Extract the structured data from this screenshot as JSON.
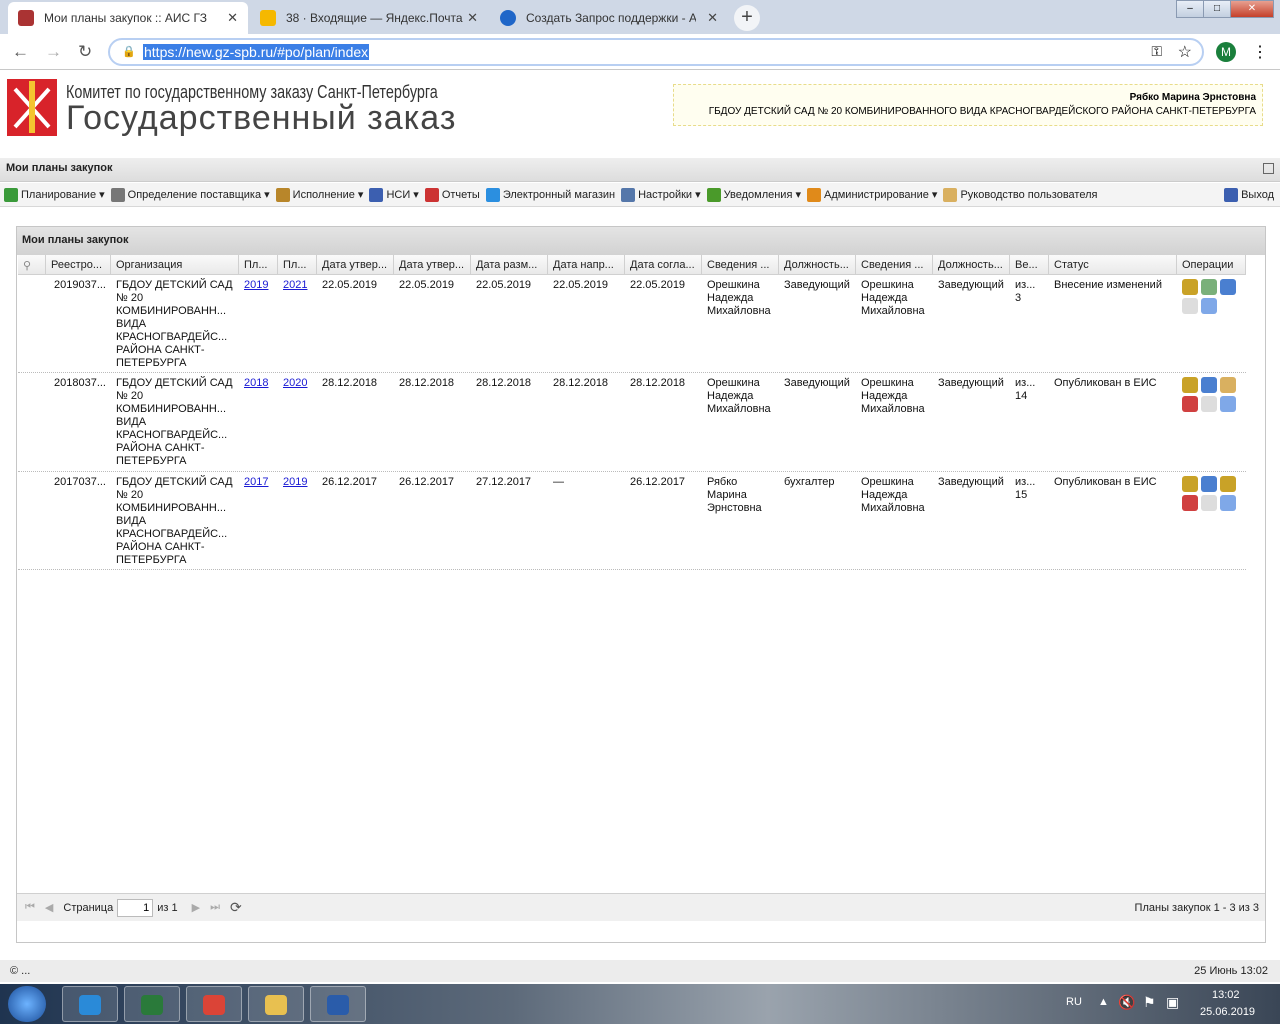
{
  "browser": {
    "tabs": [
      {
        "title": "Мои планы закупок :: АИС ГЗ",
        "icon": "hammer-icon",
        "color": "#a33"
      },
      {
        "title": "38 · Входящие — Яндекс.Почта",
        "icon": "mail-icon",
        "color": "#f5b800"
      },
      {
        "title": "Создать Запрос поддержки - АИС",
        "icon": "help-icon",
        "color": "#1f66c8"
      }
    ],
    "new_tab": "+",
    "url": "https://new.gz-spb.ru/#po/plan/index",
    "avatar": "M",
    "controls": {
      "minimize": "–",
      "maximize": "□",
      "close": "✕"
    }
  },
  "header": {
    "org_line": "Комитет по государственному заказу Санкт-Петербурга",
    "app_name": "Государственный заказ",
    "user_name": "Рябко Марина Эрнстовна",
    "user_org": "ГБДОУ ДЕТСКИЙ САД № 20 КОМБИНИРОВАННОГО ВИДА КРАСНОГВАРДЕЙСКОГО РАЙОНА САНКТ-ПЕТЕРБУРГА"
  },
  "page_title": "Мои планы закупок",
  "menu": [
    {
      "label": "Планирование ▾",
      "color": "#3a9a3a"
    },
    {
      "label": "Определение поставщика ▾",
      "color": "#777"
    },
    {
      "label": "Исполнение ▾",
      "color": "#b8862a"
    },
    {
      "label": "НСИ ▾",
      "color": "#3c5fb0"
    },
    {
      "label": "Отчеты",
      "color": "#c33"
    },
    {
      "label": "Электронный магазин",
      "color": "#2b8fe0"
    },
    {
      "label": "Настройки ▾",
      "color": "#5577aa"
    },
    {
      "label": "Уведомления ▾",
      "color": "#4a9a2a"
    },
    {
      "label": "Администрирование ▾",
      "color": "#e08a1a"
    },
    {
      "label": "Руководство пользователя",
      "color": "#d9b060"
    }
  ],
  "exit_label": "Выход",
  "panel": {
    "title": "Мои планы закупок",
    "columns": [
      "",
      "Реестро...",
      "Организация",
      "Пл...",
      "Пл...",
      "Дата утвер...",
      "Дата утвер...",
      "Дата разм...",
      "Дата напр...",
      "Дата согла...",
      "Сведения ...",
      "Должность...",
      "Сведения ...",
      "Должность...",
      "Ве...",
      "Статус",
      "Операции"
    ],
    "rows": [
      {
        "reg": "2019037...",
        "org": "ГБДОУ ДЕТСКИЙ САД\n№ 20\nКОМБИНИРОВАНН...\nВИДА\nКРАСНОГВАРДЕЙС...\nРАЙОНА САНКТ-\nПЕТЕРБУРГА",
        "y1": "2019",
        "y2": "2021",
        "d1": "22.05.2019",
        "d2": "22.05.2019",
        "d3": "22.05.2019",
        "d4": "22.05.2019",
        "d5": "22.05.2019",
        "p1": "Орешкина\nНадежда\nМихайловна",
        "pos1": "Заведующий",
        "p2": "Орешкина\nНадежда\nМихайловна",
        "pos2": "Заведующий",
        "ver": "из...\n3",
        "status": "Внесение изменений",
        "ops": [
          "emblem-icon",
          "approve-doc-icon",
          "edit-icon",
          "document-icon",
          "info-icon"
        ]
      },
      {
        "reg": "2018037...",
        "org": "ГБДОУ ДЕТСКИЙ САД\n№ 20\nКОМБИНИРОВАНН...\nВИДА\nКРАСНОГВАРДЕЙС...\nРАЙОНА САНКТ-\nПЕТЕРБУРГА",
        "y1": "2018",
        "y2": "2020",
        "d1": "28.12.2018",
        "d2": "28.12.2018",
        "d3": "28.12.2018",
        "d4": "28.12.2018",
        "d5": "28.12.2018",
        "p1": "Орешкина\nНадежда\nМихайловна",
        "pos1": "Заведующий",
        "p2": "Орешкина\nНадежда\nМихайловна",
        "pos2": "Заведующий",
        "ver": "из...\n14",
        "status": "Опубликован в ЕИС",
        "ops": [
          "emblem-icon",
          "edit-icon",
          "export-icon",
          "calendar-add-icon",
          "document-icon",
          "info-icon"
        ]
      },
      {
        "reg": "2017037...",
        "org": "ГБДОУ ДЕТСКИЙ САД\n№ 20\nКОМБИНИРОВАНН...\nВИДА\nКРАСНОГВАРДЕЙС...\nРАЙОНА САНКТ-\nПЕТЕРБУРГА",
        "y1": "2017",
        "y2": "2019",
        "d1": "26.12.2017",
        "d2": "26.12.2017",
        "d3": "27.12.2017",
        "d4": "—",
        "d5": "26.12.2017",
        "p1": "Рябко\nМарина\nЭрнстовна",
        "pos1": "бухгалтер",
        "p2": "Орешкина\nНадежда\nМихайловна",
        "pos2": "Заведующий",
        "ver": "из...\n15",
        "status": "Опубликован в ЕИС",
        "ops": [
          "emblem-icon",
          "edit-icon",
          "scroll-icon",
          "calendar-add-icon",
          "document-icon",
          "info-icon"
        ]
      }
    ],
    "pager": {
      "first": "⏮",
      "prev": "◀",
      "page_label": "Страница",
      "page": "1",
      "of": "из 1",
      "next": "▶",
      "last": "⏭",
      "refresh": "⟳",
      "info": "Планы закупок 1 - 3 из 3"
    }
  },
  "status_bar": {
    "left": "© ...",
    "right": "25 Июнь 13:02"
  },
  "taskbar": {
    "lang": "RU",
    "time": "13:02",
    "date": "25.06.2019",
    "apps": [
      {
        "name": "ie",
        "color": "#2a8ad8"
      },
      {
        "name": "excel",
        "color": "#2a7a3a"
      },
      {
        "name": "chrome",
        "color": "#db4437"
      },
      {
        "name": "explorer",
        "color": "#e8c050"
      },
      {
        "name": "word",
        "color": "#2a5caa"
      }
    ]
  }
}
